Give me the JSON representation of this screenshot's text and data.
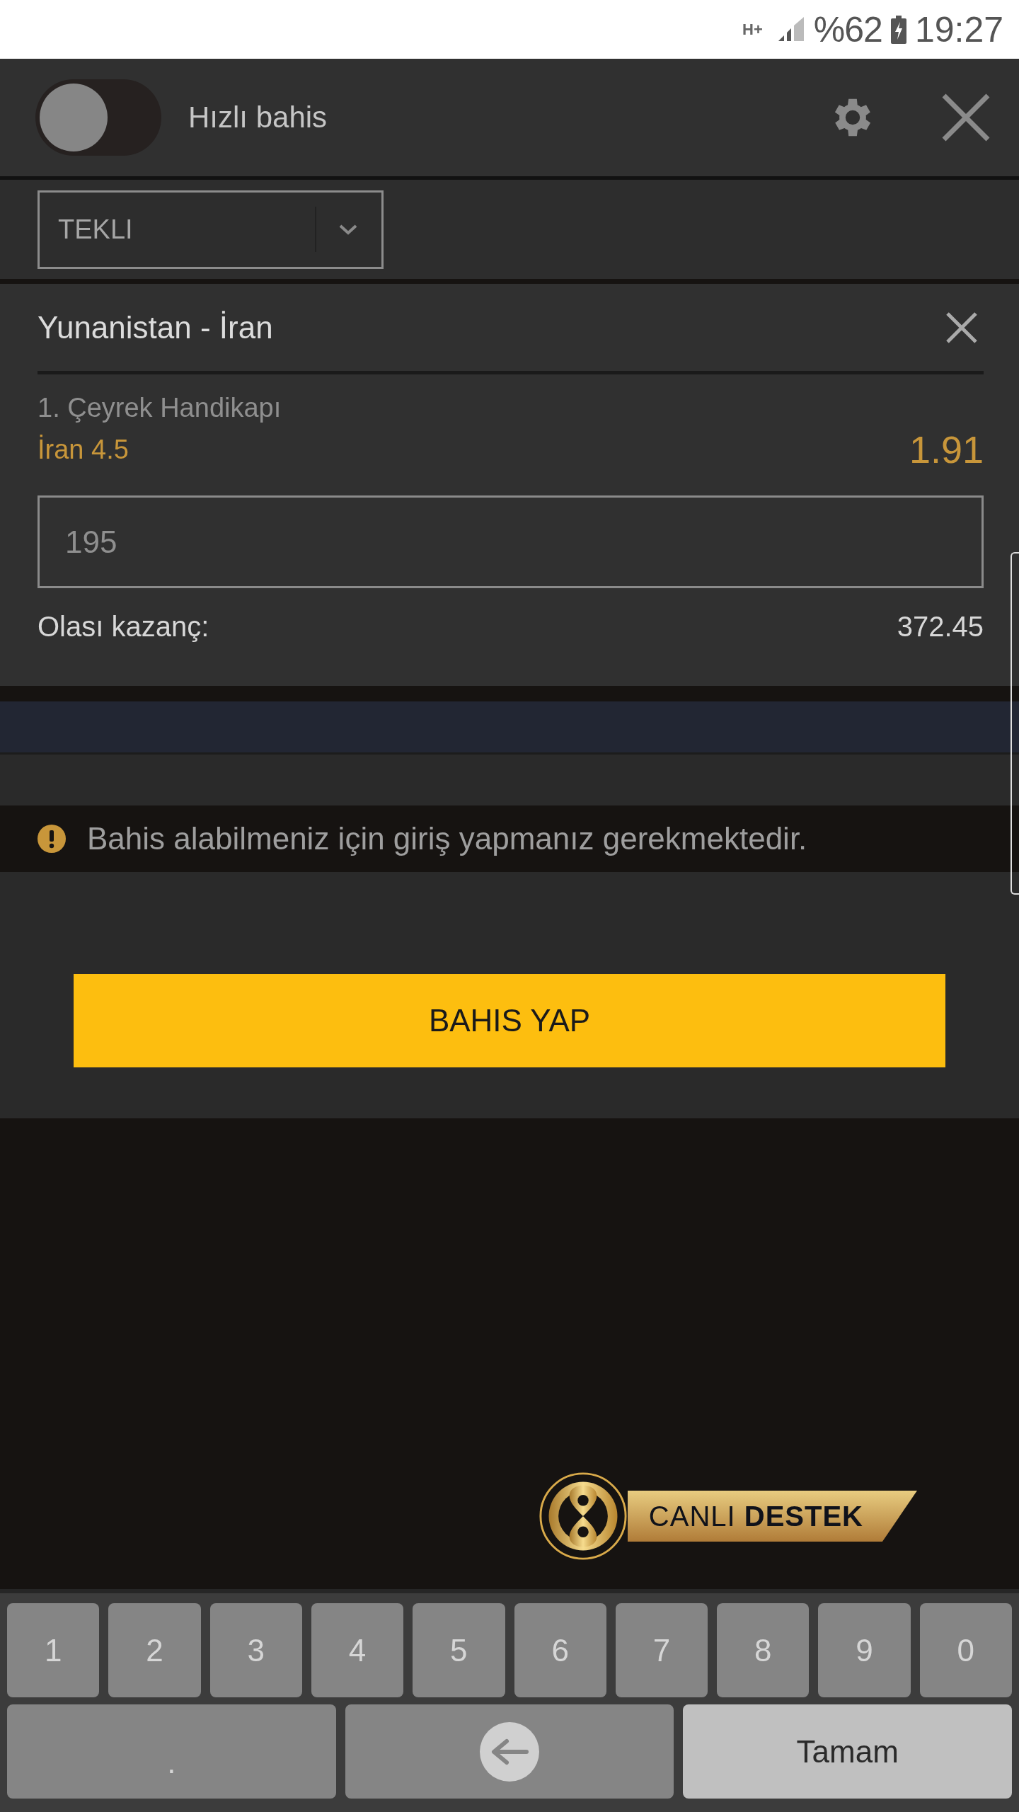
{
  "status_bar": {
    "network": "H+",
    "battery": "%62",
    "time": "19:27"
  },
  "header": {
    "quick_bet": {
      "label": "Hızlı bahis",
      "on": false
    }
  },
  "bet_type": {
    "value": "TEKLI"
  },
  "bet": {
    "match": "Yunanistan - İran",
    "market": "1. Çeyrek Handikapı",
    "selection": "İran 4.5",
    "odds": "1.91",
    "stake": "195",
    "winnings_label": "Olası kazanç:",
    "winnings": "372.45"
  },
  "notice": "Bahis alabilmeniz için giriş yapmanız gerekmektedir.",
  "place_bet_button": "BAHIS YAP",
  "live_support": "CANLI **DESTEK**",
  "keyboard": {
    "keys": [
      {
        "kind": "digit",
        "label": "1"
      },
      {
        "kind": "digit",
        "label": "2"
      },
      {
        "kind": "digit",
        "label": "3"
      },
      {
        "kind": "digit",
        "label": "4"
      },
      {
        "kind": "digit",
        "label": "5"
      },
      {
        "kind": "digit",
        "label": "6"
      },
      {
        "kind": "digit",
        "label": "7"
      },
      {
        "kind": "digit",
        "label": "8"
      },
      {
        "kind": "digit",
        "label": "9"
      },
      {
        "kind": "digit",
        "label": "0"
      },
      {
        "kind": "decimal",
        "label": "."
      },
      {
        "kind": "backspace"
      },
      {
        "kind": "done",
        "label": "Tamam"
      }
    ]
  }
}
